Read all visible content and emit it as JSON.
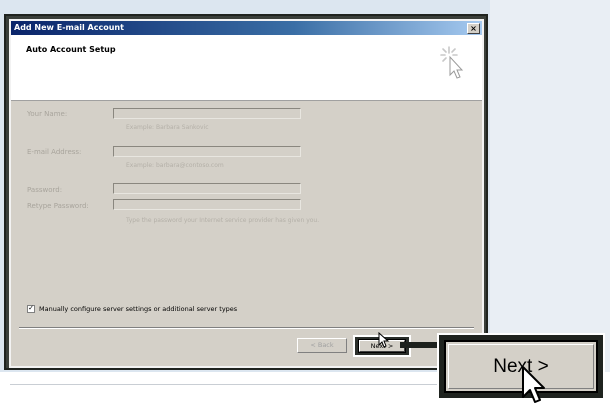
{
  "dialog": {
    "title": "Add New E-mail Account",
    "close_glyph": "×",
    "header_title": "Auto Account Setup",
    "header_icon": "wizard-sparkle-icon"
  },
  "form": {
    "name_label": "Your Name:",
    "name_hint": "Example: Barbara Sankovic",
    "email_label": "E-mail Address:",
    "email_hint": "Example: barbara@contoso.com",
    "password_label": "Password:",
    "retype_label": "Retype Password:",
    "password_hint": "Type the password your Internet service provider has given you."
  },
  "manual_config": {
    "checked": true,
    "check_glyph": "✓",
    "label": "Manually configure server settings or additional server types"
  },
  "buttons": {
    "back_label": "< Back",
    "next_label": "Next >"
  },
  "zoom_callout": {
    "label": "Next >"
  }
}
